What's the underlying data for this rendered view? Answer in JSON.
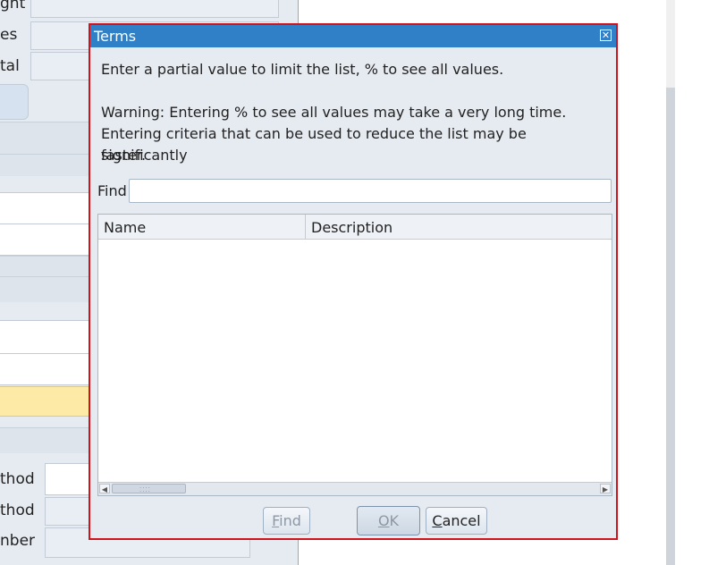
{
  "background_form": {
    "top_labels": [
      "ght",
      "es",
      "tal"
    ],
    "bottom_labels": [
      "thod",
      "thod",
      "nber"
    ]
  },
  "dialog": {
    "title": "Terms",
    "close_icon": "close-icon",
    "instruction": "Enter a partial value to limit the list, % to see all values.",
    "warning_lines": [
      "Warning: Entering % to see all values may take a very long time.",
      "Entering criteria that can be used to reduce the list may be significantly",
      "faster."
    ],
    "find": {
      "label": "Find",
      "value": ""
    },
    "grid": {
      "columns": [
        "Name",
        "Description"
      ],
      "rows": []
    },
    "buttons": {
      "find": {
        "mnemonic": "F",
        "rest": "ind",
        "enabled": false
      },
      "ok": {
        "mnemonic": "O",
        "rest": "K",
        "enabled": false
      },
      "cancel": {
        "mnemonic": "C",
        "rest": "ancel",
        "enabled": true
      }
    }
  },
  "colors": {
    "title_bar": "#2f80c6",
    "dialog_border": "#d0121b",
    "dialog_bg": "#e6ebf2",
    "highlight_row": "#fdeaa6"
  }
}
